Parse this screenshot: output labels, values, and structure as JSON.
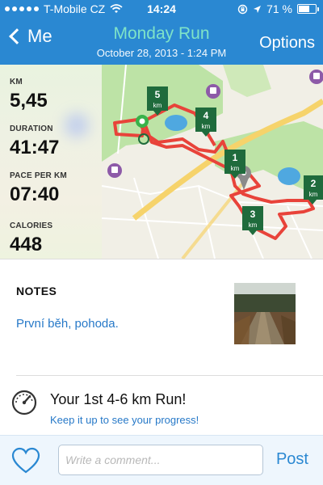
{
  "status_bar": {
    "carrier": "T-Mobile CZ",
    "time": "14:24",
    "battery": "71 %",
    "battery_level": 0.71,
    "icons": [
      "signal-dots-icon",
      "wifi-icon",
      "rotation-lock-icon",
      "location-arrow-icon",
      "battery-icon"
    ]
  },
  "nav": {
    "back_label": "Me",
    "title": "Monday Run",
    "subtitle": "October 28, 2013 - 1:24 PM",
    "options_label": "Options"
  },
  "stats": [
    {
      "label": "KM",
      "value": "5,45"
    },
    {
      "label": "DURATION",
      "value": "41:47"
    },
    {
      "label": "PACE PER KM",
      "value": "07:40"
    },
    {
      "label": "CALORIES",
      "value": "448"
    }
  ],
  "map": {
    "km_markers": [
      {
        "number": "1",
        "unit": "km"
      },
      {
        "number": "2",
        "unit": "km"
      },
      {
        "number": "3",
        "unit": "km"
      },
      {
        "number": "4",
        "unit": "km"
      },
      {
        "number": "5",
        "unit": "km"
      }
    ],
    "colors": {
      "route": "#e8433a",
      "park": "#bde3a6",
      "water": "#4fa8e0",
      "road": "#f6d36b",
      "marker": "#1f6b3c"
    }
  },
  "notes": {
    "title": "NOTES",
    "text": "První běh, pohoda."
  },
  "achievement": {
    "title": "Your 1st 4-6 km Run!",
    "subtitle": "Keep it up to see your progress!"
  },
  "comment_bar": {
    "placeholder": "Write a comment...",
    "post_label": "Post"
  },
  "colors": {
    "accent": "#2a88d2",
    "title_accent": "#7fe3c8"
  }
}
